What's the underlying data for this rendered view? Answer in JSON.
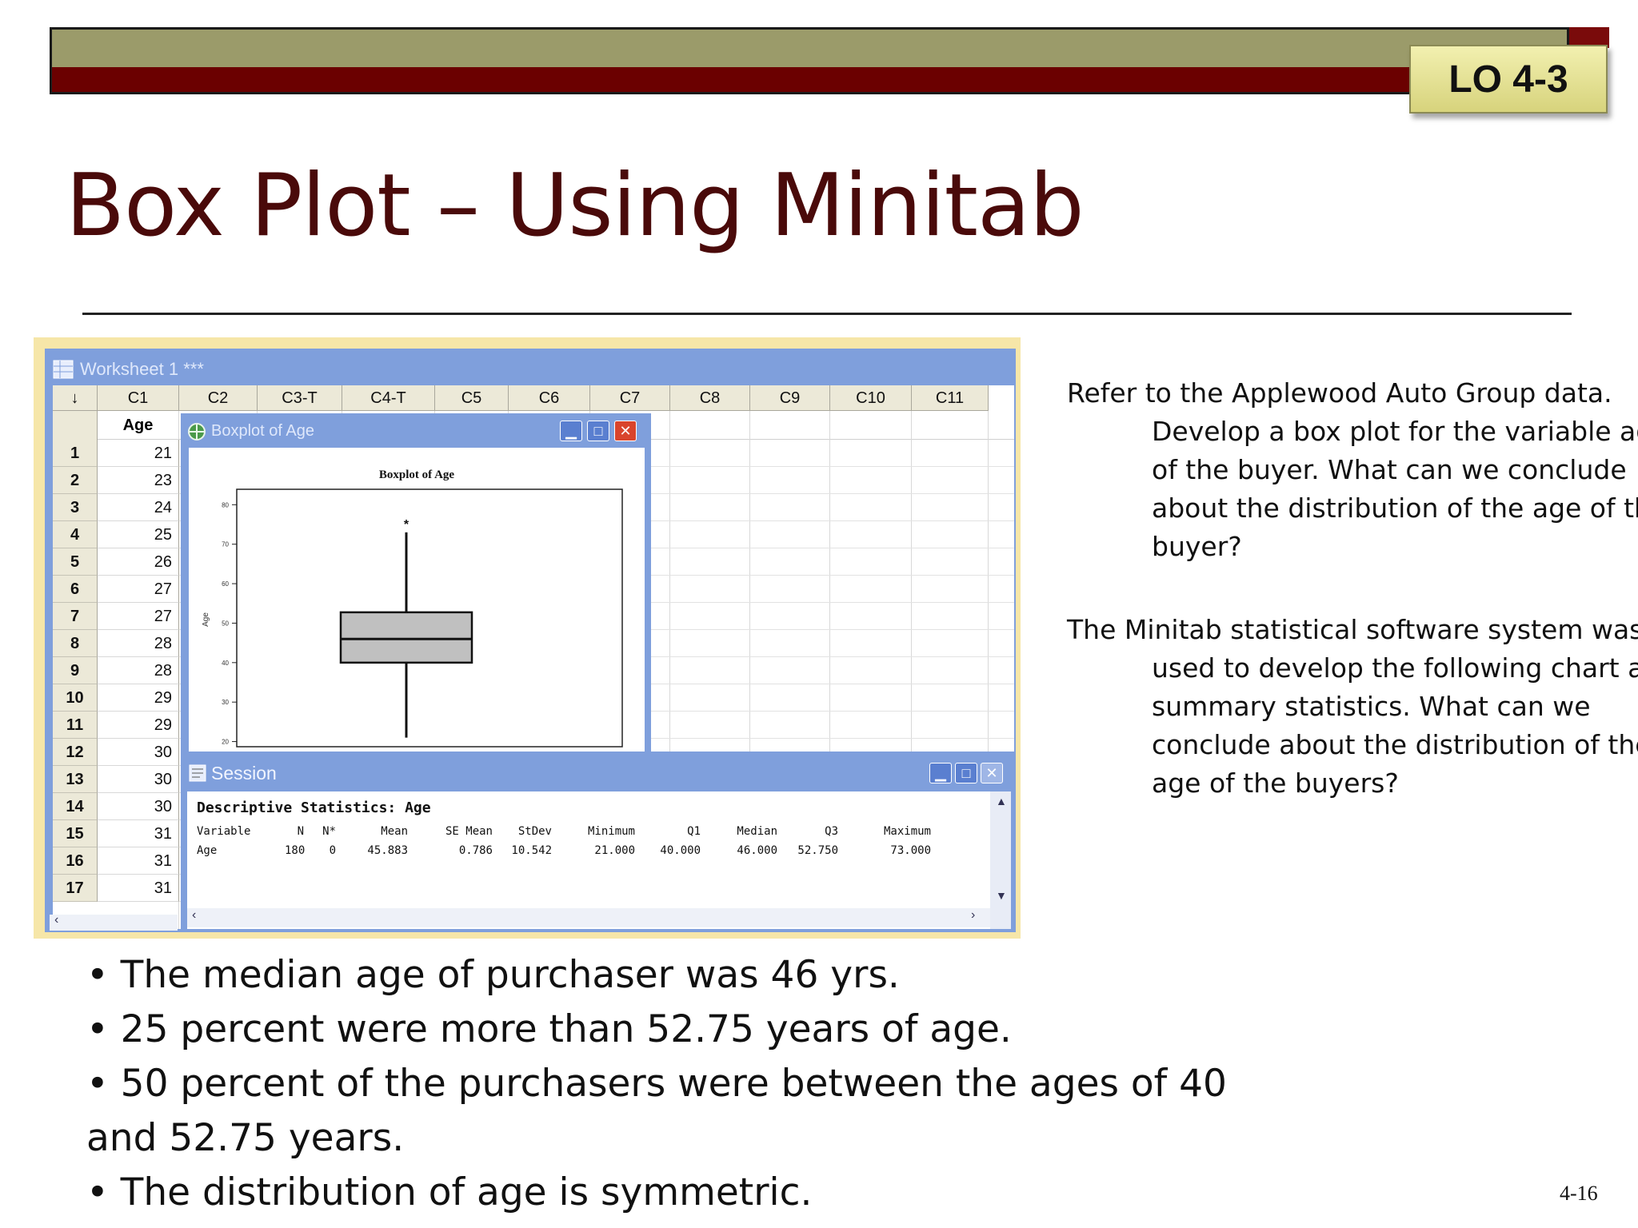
{
  "slide": {
    "badge": "LO 4-3",
    "title": "Box Plot – Using Minitab",
    "page_number": "4-16"
  },
  "worksheet": {
    "title": "Worksheet 1 ***",
    "corner_symbol": "↓",
    "columns": [
      "C1",
      "C2",
      "C3-T",
      "C4-T",
      "C5",
      "C6",
      "C7",
      "C8",
      "C9",
      "C10",
      "C11"
    ],
    "column_name": "Age",
    "rows": [
      {
        "n": "1",
        "age": "21"
      },
      {
        "n": "2",
        "age": "23"
      },
      {
        "n": "3",
        "age": "24"
      },
      {
        "n": "4",
        "age": "25"
      },
      {
        "n": "5",
        "age": "26"
      },
      {
        "n": "6",
        "age": "27"
      },
      {
        "n": "7",
        "age": "27"
      },
      {
        "n": "8",
        "age": "28"
      },
      {
        "n": "9",
        "age": "28"
      },
      {
        "n": "10",
        "age": "29"
      },
      {
        "n": "11",
        "age": "29"
      },
      {
        "n": "12",
        "age": "30"
      },
      {
        "n": "13",
        "age": "30"
      },
      {
        "n": "14",
        "age": "30"
      },
      {
        "n": "15",
        "age": "31"
      },
      {
        "n": "16",
        "age": "31"
      },
      {
        "n": "17",
        "age": "31"
      }
    ]
  },
  "boxplot_window": {
    "title": "Boxplot of Age"
  },
  "chart_data": {
    "type": "boxplot",
    "title": "Boxplot of Age",
    "ylabel": "Age",
    "ylim": [
      20,
      80
    ],
    "yticks": [
      "20",
      "30",
      "40",
      "50",
      "60",
      "70",
      "80"
    ],
    "whisker_low": 21,
    "q1": 40,
    "median": 46,
    "q3": 52.75,
    "whisker_high": 73,
    "outliers": [
      75
    ],
    "grid": false
  },
  "session": {
    "title": "Session",
    "heading": "Descriptive Statistics: Age",
    "headers": [
      "Variable",
      "N",
      "N*",
      "Mean",
      "SE Mean",
      "StDev",
      "Minimum",
      "Q1",
      "Median",
      "Q3",
      "Maximum"
    ],
    "values": [
      "Age",
      "180",
      "0",
      "45.883",
      "0.786",
      "10.542",
      "21.000",
      "40.000",
      "46.000",
      "52.750",
      "73.000"
    ]
  },
  "right_text": {
    "p1": "Refer to the Applewood Auto Group data. Develop a box plot for the variable age of the buyer. What can we conclude about the distribution of the age of the buyer?",
    "p2": "The Minitab statistical software system was used to develop the following chart and summary statistics. What can we conclude about the distribution of the age of the buyers?"
  },
  "bullets": [
    "The median age of purchaser was 46 yrs.",
    "25 percent were more than 52.75 years of age.",
    "50 percent of the purchasers were between the ages of 40 and 52.75 years.",
    "The distribution of age is symmetric."
  ]
}
